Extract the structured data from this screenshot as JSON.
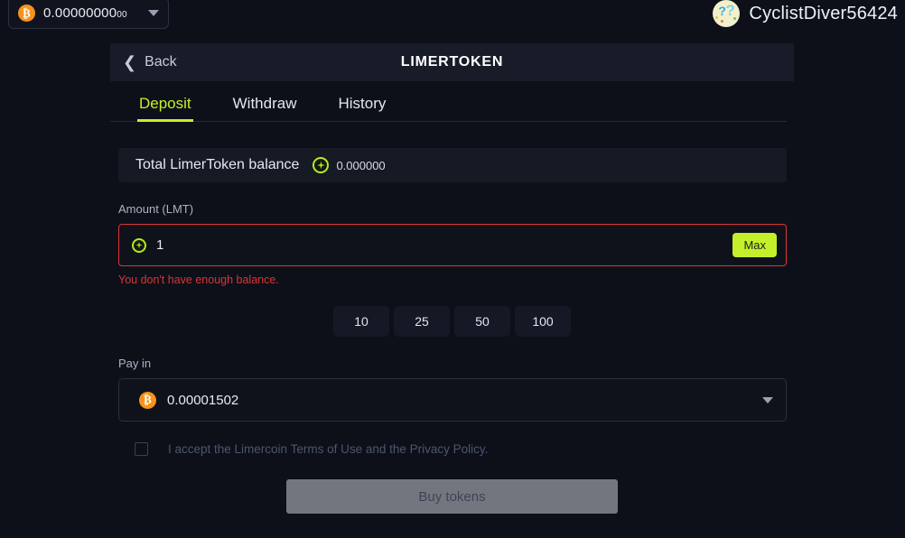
{
  "topbar": {
    "wallet_balance": "0.00000000",
    "wallet_balance_sub": "00",
    "wallet_icon": "bitcoin-icon",
    "caret_icon": "chevron-down-icon",
    "username": "CyclistDiver56424",
    "avatar_icon": "question-mark-avatar"
  },
  "header": {
    "back_label": "Back",
    "back_icon": "chevron-left-icon",
    "title": "LIMERTOKEN"
  },
  "tabs": [
    {
      "label": "Deposit",
      "active": true
    },
    {
      "label": "Withdraw",
      "active": false
    },
    {
      "label": "History",
      "active": false
    }
  ],
  "balance_strip": {
    "label": "Total LimerToken balance",
    "token_icon": "limertoken-icon",
    "value": "0.000000"
  },
  "amount": {
    "label": "Amount (LMT)",
    "token_icon": "limertoken-icon",
    "value": "1",
    "max_label": "Max",
    "error": "You don't have enough balance."
  },
  "quick_amounts": [
    "10",
    "25",
    "50",
    "100"
  ],
  "pay_in": {
    "label": "Pay in",
    "currency_icon": "bitcoin-icon",
    "value": "0.00001502",
    "caret_icon": "chevron-down-icon"
  },
  "terms": {
    "checked": false,
    "text": "I accept the Limercoin Terms of Use and the Privacy Policy."
  },
  "submit": {
    "label": "Buy tokens",
    "disabled": true
  },
  "colors": {
    "page_bg": "#0d1019",
    "panel_bg": "#181c28",
    "accent_lime": "#c3f02a",
    "error_red": "#d93636",
    "bitcoin_orange": "#f7931a",
    "disabled_gray": "#73767f"
  }
}
